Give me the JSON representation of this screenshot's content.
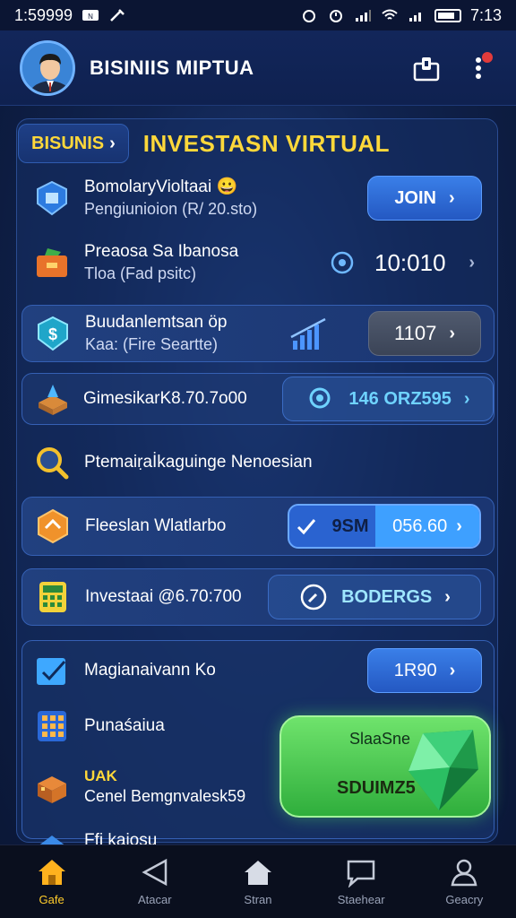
{
  "status_bar": {
    "time": "1:59999",
    "clock_right": "7:13"
  },
  "header": {
    "title": "BISINIIS MIPTUA"
  },
  "section": {
    "crumb_label": "BISUNIS",
    "title": "INVESTASN VIRTUAL"
  },
  "rows": [
    {
      "title": "BomolaryVioltaai 😀",
      "subtitle": "Pengiunioion (R/ 20.sto)",
      "action_label": "JOIN"
    },
    {
      "title": "Preaosa Sa Ibanosa",
      "subtitle": "Tloa (Fad psitc)",
      "action_label": "10:010"
    },
    {
      "title": "Buudanlemtsan öp",
      "subtitle": "Kaa: (Fire Seartte)",
      "action_label": "1107"
    },
    {
      "title": "GimesikarK8.70.7o00",
      "action_label": "146 ORZ595"
    },
    {
      "title": "Ptemaiṛaİkaguinge Nenoesian"
    },
    {
      "title": "Fleeslan Wlatlarbo",
      "action_left": "9SM",
      "action_right": "056.60"
    },
    {
      "title": "Investaai @6.70:700",
      "action_label": "BODERGS"
    },
    {
      "title": "Magianaivann Ko",
      "action_label": "1R90"
    },
    {
      "title": "Punaśaiua"
    },
    {
      "title": "UAK",
      "subtitle": "Cenel Bemgnvalesk59"
    },
    {
      "title": "Ffi kaiosu"
    }
  ],
  "cta": {
    "label": "SlaaSne",
    "main": "SDUIMZ5"
  },
  "nav": [
    {
      "label": "Gafe",
      "icon": "home-icon"
    },
    {
      "label": "Atacar",
      "icon": "triangle-icon"
    },
    {
      "label": "Stran",
      "icon": "house-icon"
    },
    {
      "label": "Staehear",
      "icon": "message-icon"
    },
    {
      "label": "Geacry",
      "icon": "profile-icon"
    }
  ],
  "colors": {
    "accent_yellow": "#ffd83a",
    "primary_blue": "#2f6bd8",
    "green": "#3dbb47",
    "background": "#10234f"
  }
}
